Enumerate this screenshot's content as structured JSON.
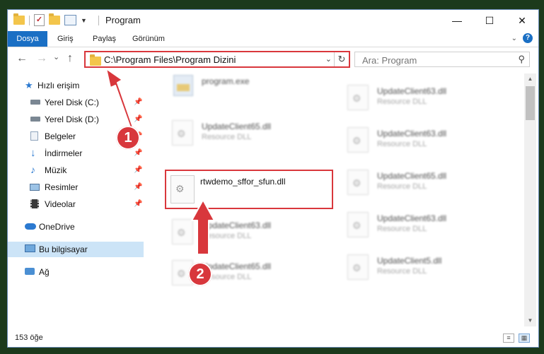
{
  "window": {
    "title": "Program",
    "controls": {
      "minimize": "—",
      "maximize": "☐",
      "close": "✕"
    }
  },
  "ribbon": {
    "tabs": [
      "Dosya",
      "Giriş",
      "Paylaş",
      "Görünüm"
    ]
  },
  "navigation": {
    "back": "←",
    "forward": "→",
    "recent": "⌄",
    "up": "↑",
    "address_path": "C:\\Program Files\\Program Dizini",
    "search_placeholder": "Ara: Program"
  },
  "sidebar": {
    "items": [
      {
        "label": "Hızlı erişim",
        "icon": "star-icon",
        "pinned": false
      },
      {
        "label": "Yerel Disk (C:)",
        "icon": "drive-icon",
        "pinned": true
      },
      {
        "label": "Yerel Disk (D:)",
        "icon": "drive-icon",
        "pinned": true
      },
      {
        "label": "Belgeler",
        "icon": "documents-icon",
        "pinned": true
      },
      {
        "label": "İndirmeler",
        "icon": "download-icon",
        "pinned": true
      },
      {
        "label": "Müzik",
        "icon": "music-icon",
        "pinned": true
      },
      {
        "label": "Resimler",
        "icon": "pictures-icon",
        "pinned": true
      },
      {
        "label": "Videolar",
        "icon": "video-icon",
        "pinned": true
      },
      {
        "label": "OneDrive",
        "icon": "cloud-icon",
        "pinned": false
      },
      {
        "label": "Bu bilgisayar",
        "icon": "computer-icon",
        "pinned": false,
        "selected": true
      },
      {
        "label": "Ağ",
        "icon": "network-icon",
        "pinned": false
      }
    ]
  },
  "files": [
    {
      "name": "program.exe",
      "type": "",
      "kind": "exe"
    },
    {
      "name": "UpdateClient63.dll",
      "type": "Resource DLL",
      "kind": "dll"
    },
    {
      "name": "UpdateClient65.dll",
      "type": "Resource DLL",
      "kind": "dll"
    },
    {
      "name": "UpdateClient63.dll",
      "type": "Resource DLL",
      "kind": "dll"
    },
    {
      "name": "rtwdemo_sffor_sfun.dll",
      "type": "",
      "kind": "dll",
      "highlighted": true
    },
    {
      "name": "UpdateClient65.dll",
      "type": "Resource DLL",
      "kind": "dll"
    },
    {
      "name": "UpdateClient63.dll",
      "type": "Resource DLL",
      "kind": "dll"
    },
    {
      "name": "UpdateClient63.dll",
      "type": "Resource DLL",
      "kind": "dll"
    },
    {
      "name": "UpdateClient65.dll",
      "type": "Resource DLL",
      "kind": "dll"
    },
    {
      "name": "UpdateClient5.dll",
      "type": "Resource DLL",
      "kind": "dll"
    }
  ],
  "status": {
    "item_count": "153 öğe"
  },
  "annotations": {
    "step1": "1",
    "step2": "2",
    "highlight_color": "#d9373c"
  }
}
